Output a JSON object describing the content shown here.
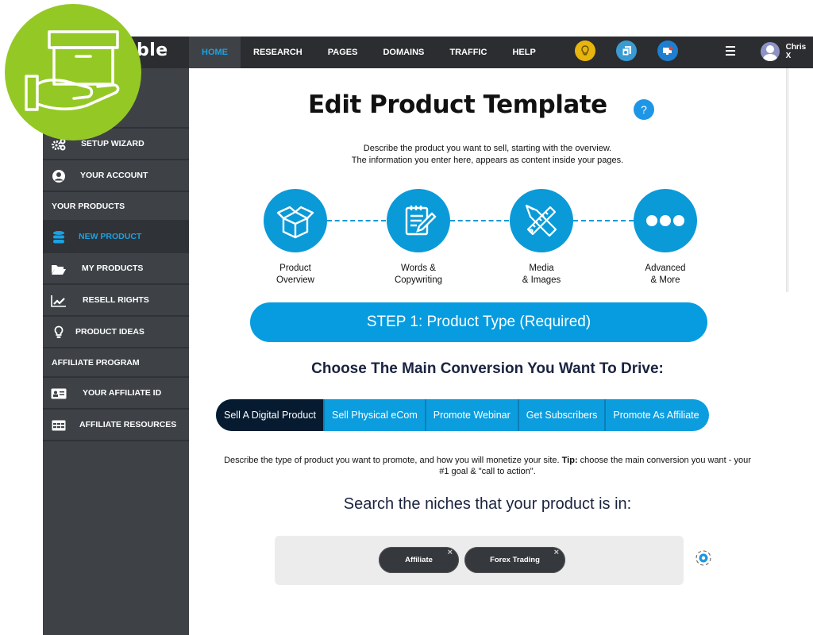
{
  "brand": {
    "name_visible": "ble"
  },
  "nav": {
    "items": [
      {
        "label": "HOME",
        "active": true
      },
      {
        "label": "RESEARCH",
        "active": false
      },
      {
        "label": "PAGES",
        "active": false
      },
      {
        "label": "DOMAINS",
        "active": false
      },
      {
        "label": "TRAFFIC",
        "active": false
      },
      {
        "label": "HELP",
        "active": false
      }
    ],
    "icons": [
      "lightbulb-icon",
      "layers-icon",
      "monitor-notification-icon",
      "menu-icon"
    ],
    "user_name": "Chris X"
  },
  "sidebar": {
    "items": [
      {
        "label": "SETUP WIZARD",
        "icon": "gears-icon"
      },
      {
        "label": "YOUR ACCOUNT",
        "icon": "user-circle-icon"
      }
    ],
    "section_products": "YOUR PRODUCTS",
    "product_items": [
      {
        "label": "NEW PRODUCT",
        "icon": "database-icon",
        "active": true
      },
      {
        "label": "MY PRODUCTS",
        "icon": "folder-open-icon"
      },
      {
        "label": "RESELL RIGHTS",
        "icon": "chart-line-icon"
      },
      {
        "label": "PRODUCT IDEAS",
        "icon": "lightbulb-icon"
      }
    ],
    "section_affiliate": "AFFILIATE PROGRAM",
    "affiliate_items": [
      {
        "label": "YOUR AFFILIATE ID",
        "icon": "id-card-icon"
      },
      {
        "label": "AFFILIATE RESOURCES",
        "icon": "table-icon"
      }
    ]
  },
  "main": {
    "title": "Edit Product Template",
    "help_label": "?",
    "intro_line1": "Describe the product you want to sell, starting with the overview.",
    "intro_line2": "The information you enter here, appears as content inside your pages.",
    "steps": [
      {
        "label": "Product\nOverview",
        "icon": "box-open-icon"
      },
      {
        "label": "Words &\nCopywriting",
        "icon": "notepad-pencil-icon"
      },
      {
        "label": "Media\n& Images",
        "icon": "pencil-ruler-icon"
      },
      {
        "label": "Advanced\n& More",
        "icon": "more-dots-icon"
      }
    ],
    "step_banner": "STEP 1: Product Type (Required)",
    "conversion_heading": "Choose The Main Conversion You Want To Drive:",
    "conversion_tabs": [
      {
        "label": "Sell A Digital Product",
        "active": true
      },
      {
        "label": "Sell Physical eCom",
        "active": false
      },
      {
        "label": "Promote Webinar",
        "active": false
      },
      {
        "label": "Get Subscribers",
        "active": false
      },
      {
        "label": "Promote As Affiliate",
        "active": false
      }
    ],
    "desc_text": "Describe the type of product you want to promote, and how you will monetize your site. ",
    "desc_tip_label": "Tip:",
    "desc_tip_text": " choose the main conversion you want - your #1 goal & \"call to action\".",
    "niche_heading": "Search the niches that your product is in:",
    "niches": [
      {
        "label": "Affiliate",
        "remove": "×"
      },
      {
        "label": "Forex Trading",
        "remove": "×"
      }
    ]
  },
  "colors": {
    "accent": "#0a9ad8",
    "nav_bg": "#2b2d30",
    "sidebar_bg": "#3e4247",
    "badge_green": "#94c925",
    "active_tab": "#071b30"
  }
}
